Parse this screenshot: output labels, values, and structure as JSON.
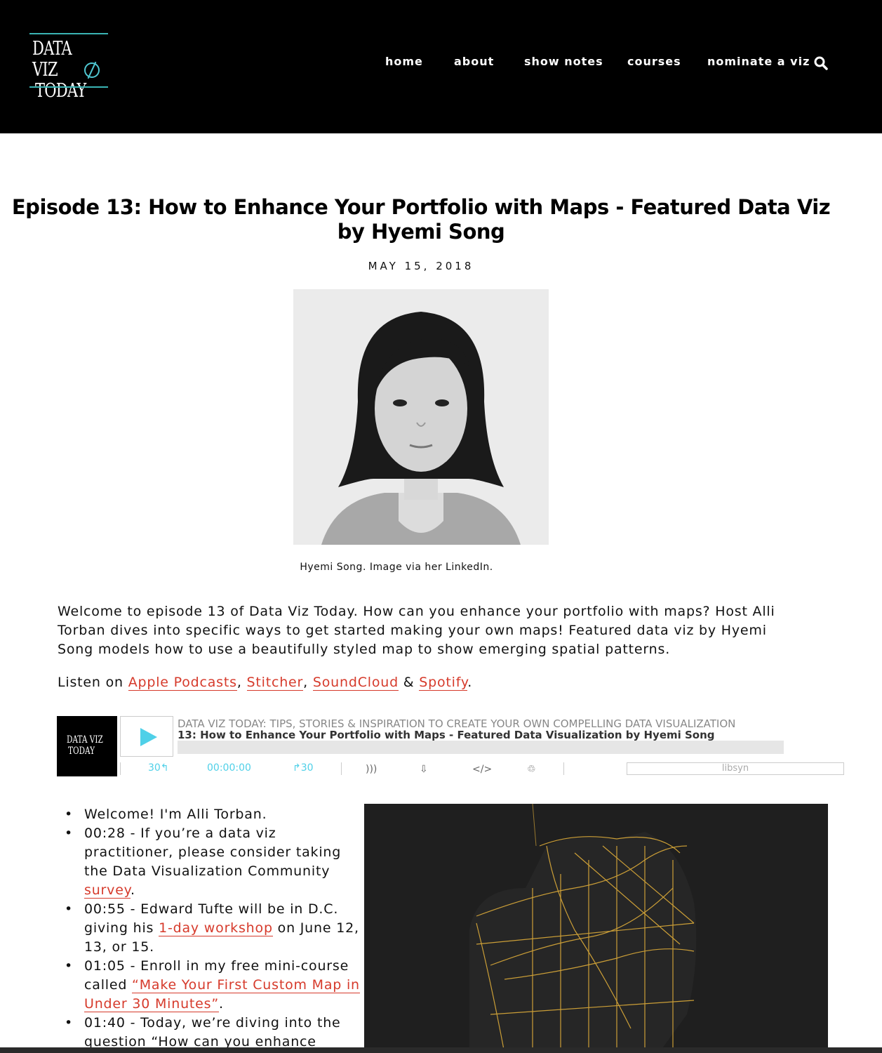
{
  "header": {
    "logo_line1": "DATA VIZ",
    "logo_line2": "TODAY",
    "nav": [
      "home",
      "about",
      "show notes",
      "courses",
      "nominate a viz"
    ],
    "search_icon": "search-icon"
  },
  "post": {
    "title": "Episode 13: How to Enhance Your Portfolio with Maps - Featured Data Viz by Hyemi Song",
    "date": "MAY 15, 2018",
    "caption": "Hyemi Song. Image via her LinkedIn.",
    "intro": "Welcome to episode 13 of Data Viz Today. How can you enhance your portfolio with maps? Host Alli Torban dives into specific ways to get started making your own maps! Featured data viz by Hyemi Song models how to use a beautifully styled map to show emerging spatial patterns.",
    "listen_prefix": "Listen on ",
    "links": [
      "Apple Podcasts",
      "Stitcher",
      "SoundCloud",
      "Spotify"
    ],
    "comma": ",",
    "amp": " & ",
    "period": "."
  },
  "player": {
    "art_line1": "DATA VIZ",
    "art_line2": "TODAY",
    "show": "DATA VIZ TODAY: TIPS, STORIES & INSPIRATION TO CREATE YOUR OWN COMPELLING DATA VISUALIZATION",
    "episode": "13: How to Enhance Your Portfolio with Maps - Featured Data Visualization by Hyemi Song",
    "back": "30↰",
    "time": "00:00:00",
    "forward": "↱30",
    "brand": "libsyn",
    "progress": 0
  },
  "notes": {
    "n1": "Welcome! I'm Alli Torban.",
    "n2a": "00:28 - If you’re a data viz practitioner, please consider taking the Data Visualization Community ",
    "n2link": "survey",
    "n2b": ".",
    "n3a": "00:55 - Edward Tufte will be in D.C. giving his ",
    "n3link": "1-day workshop",
    "n3b": " on June 12, 13, or 15.",
    "n4a": "01:05 - Enroll in my free mini-course called ",
    "n4link": "“Make Your First Custom Map in Under 30 Minutes”",
    "n4b": ".",
    "n5": "01:40 - Today, we’re diving into the question “How can you enhance"
  },
  "colors": {
    "accent": "#d63a2b",
    "player_accent": "#4fd0e8",
    "map_line": "#e8b43a",
    "header_bg": "#000000"
  }
}
